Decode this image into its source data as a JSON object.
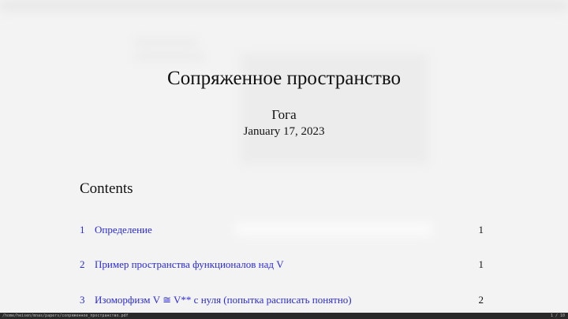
{
  "document": {
    "title": "Сопряженное пространство",
    "author": "Гога",
    "date": "January 17, 2023"
  },
  "toc": {
    "heading": "Contents",
    "entries": [
      {
        "number": "1",
        "title": "Определение",
        "page": "1"
      },
      {
        "number": "2",
        "title": "Пример пространства функционалов над V",
        "page": "1"
      },
      {
        "number": "3",
        "title": "Изоморфизм V ≅ V** с нуля (попытка расписать понятно)",
        "page": "2"
      }
    ]
  },
  "statusbar": {
    "path": "/home/heisen/mnas/papers/сопряженное_пространство.pdf",
    "page_indicator": "1 / 10"
  },
  "colors": {
    "link": "#2b2bd6",
    "background": "#f3f3f3",
    "statusbar": "#2a2a2a"
  }
}
